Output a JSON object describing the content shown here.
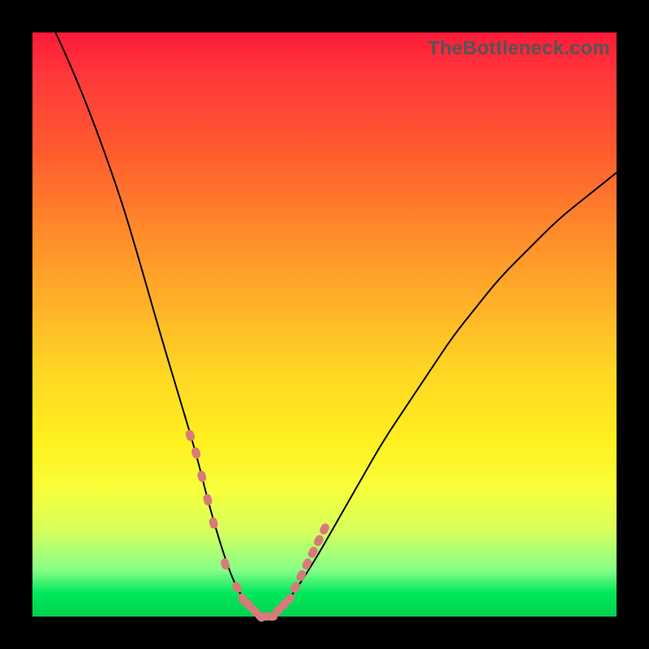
{
  "watermark": "TheBottleneck.com",
  "colors": {
    "frame": "#000000",
    "curve": "#000000",
    "marker": "#d87a7a",
    "gradient_top": "#ff1a3a",
    "gradient_bottom": "#00d050"
  },
  "chart_data": {
    "type": "line",
    "title": "",
    "xlabel": "",
    "ylabel": "",
    "xlim": [
      0,
      100
    ],
    "ylim": [
      0,
      100
    ],
    "grid": false,
    "legend": false,
    "annotations": [
      "TheBottleneck.com"
    ],
    "series": [
      {
        "name": "bottleneck-curve",
        "x": [
          0,
          5,
          10,
          15,
          18,
          22,
          25,
          28,
          30,
          32,
          34,
          36,
          38,
          40,
          42,
          44,
          48,
          52,
          56,
          60,
          64,
          68,
          72,
          76,
          80,
          85,
          90,
          95,
          100
        ],
        "values": [
          108,
          98,
          86,
          72,
          62,
          48,
          38,
          28,
          20,
          13,
          7,
          3,
          1,
          0,
          1,
          3,
          9,
          16,
          23,
          30,
          36,
          42,
          48,
          53,
          58,
          63,
          68,
          72,
          76
        ]
      }
    ],
    "markers": {
      "name": "highlighted-points",
      "x": [
        27,
        28,
        29,
        30,
        31,
        33,
        35,
        36,
        37,
        38,
        39,
        40,
        41,
        42,
        43,
        44,
        45,
        46,
        47,
        48,
        49,
        50
      ],
      "values": [
        31,
        28,
        24,
        20,
        16,
        9,
        5,
        3,
        2,
        1,
        0,
        0,
        0,
        1,
        2,
        3,
        5,
        7,
        9,
        11,
        13,
        15
      ]
    }
  }
}
